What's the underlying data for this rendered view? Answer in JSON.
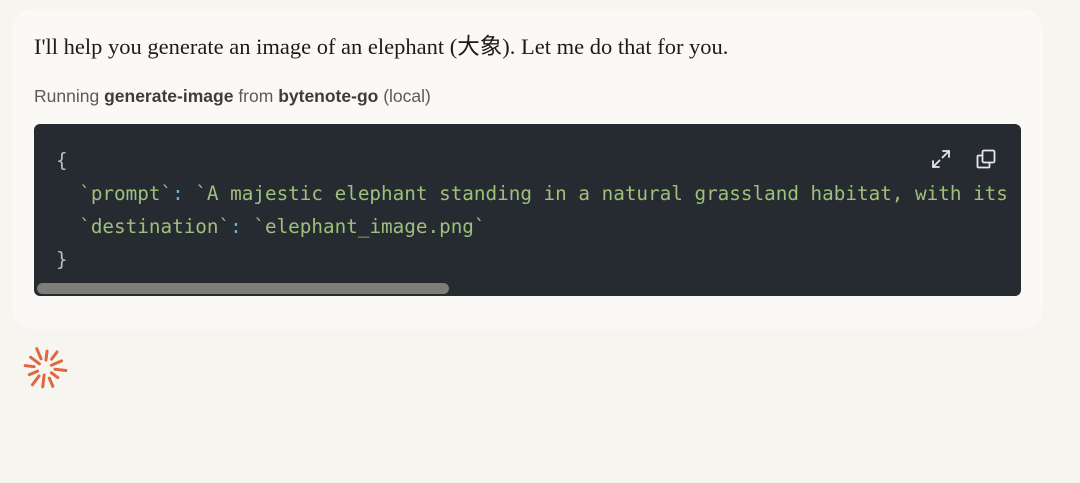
{
  "message": {
    "text": "I'll help you generate an image of an elephant (大象). Let me do that for you."
  },
  "tool_call": {
    "prefix": "Running",
    "tool_name": "generate-image",
    "middle": "from",
    "server_name": "bytenote-go",
    "suffix": "(local)"
  },
  "code": {
    "open_brace": "{",
    "prompt_key": "`prompt`",
    "prompt_value": "`A majestic elephant standing in a natural grassland habitat, with its",
    "destination_key": "`destination`",
    "destination_value": "`elephant_image.png`",
    "colon": ":",
    "close_brace": "}",
    "scrollbar_position": 0.0,
    "scrollbar_visible_fraction": 0.42
  },
  "icons": {
    "expand": "expand-icon",
    "copy": "copy-icon",
    "spinner": "loading-spinner-icon"
  },
  "colors": {
    "page_background": "#f7f5f0",
    "code_background": "#262a31",
    "string": "#9dc07a",
    "spinner": "#e0683f"
  }
}
